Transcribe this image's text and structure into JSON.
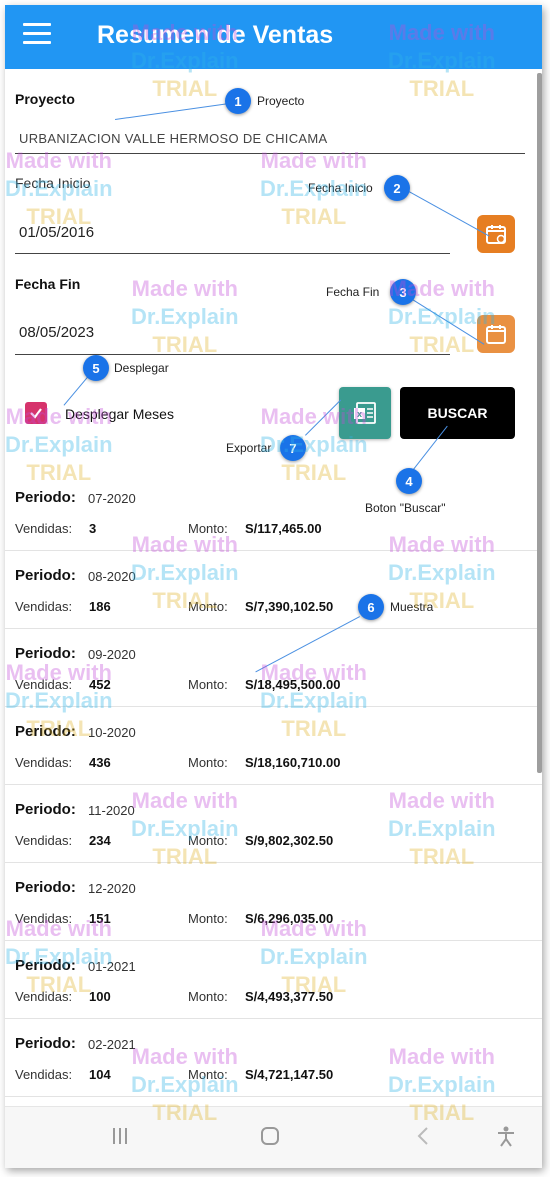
{
  "app": {
    "title": "Resumen de Ventas"
  },
  "form": {
    "proyecto_label": "Proyecto",
    "proyecto_value": "URBANIZACION VALLE HERMOSO DE CHICAMA",
    "fecha_inicio_label": "Fecha Inicio",
    "fecha_inicio_value": "01/05/2016",
    "fecha_fin_label": "Fecha Fin",
    "fecha_fin_value": "08/05/2023",
    "desplegar_label": "Desplegar Meses",
    "desplegar_checked": true,
    "buscar_label": "BUSCAR"
  },
  "callouts": [
    {
      "num": "1",
      "text": "Proyecto"
    },
    {
      "num": "2",
      "text": "Fecha Inicio"
    },
    {
      "num": "3",
      "text": "Fecha Fin"
    },
    {
      "num": "4",
      "text": "Boton \"Buscar\""
    },
    {
      "num": "5",
      "text": "Desplegar"
    },
    {
      "num": "6",
      "text": "Muestra"
    },
    {
      "num": "7",
      "text": "Exportar"
    }
  ],
  "list_labels": {
    "periodo": "Periodo:",
    "vendidas": "Vendidas:",
    "monto": "Monto:"
  },
  "rows": [
    {
      "periodo": "07-2020",
      "vendidas": "3",
      "monto": "S/117,465.00"
    },
    {
      "periodo": "08-2020",
      "vendidas": "186",
      "monto": "S/7,390,102.50"
    },
    {
      "periodo": "09-2020",
      "vendidas": "452",
      "monto": "S/18,495,500.00"
    },
    {
      "periodo": "10-2020",
      "vendidas": "436",
      "monto": "S/18,160,710.00"
    },
    {
      "periodo": "11-2020",
      "vendidas": "234",
      "monto": "S/9,802,302.50"
    },
    {
      "periodo": "12-2020",
      "vendidas": "151",
      "monto": "S/6,296,035.00"
    },
    {
      "periodo": "01-2021",
      "vendidas": "100",
      "monto": "S/4,493,377.50"
    },
    {
      "periodo": "02-2021",
      "vendidas": "104",
      "monto": "S/4,721,147.50"
    }
  ],
  "watermark": {
    "line1": "Made with",
    "line2": "Dr.Explain",
    "line3": "TRIAL"
  },
  "icons": {
    "menu": "hamburger-icon",
    "calendar": "calendar-icon",
    "excel": "excel-icon",
    "check": "checkmark-icon",
    "nav_recent": "recent-apps-icon",
    "nav_home": "home-icon",
    "nav_back": "back-icon",
    "nav_accessibility": "accessibility-icon"
  },
  "colors": {
    "appbar": "#2196f3",
    "calendar_button": "#e67e22",
    "checkbox": "#d6336c",
    "excel_button": "#3a9b8f",
    "buscar_button": "#000000",
    "callout": "#1a73e8"
  }
}
